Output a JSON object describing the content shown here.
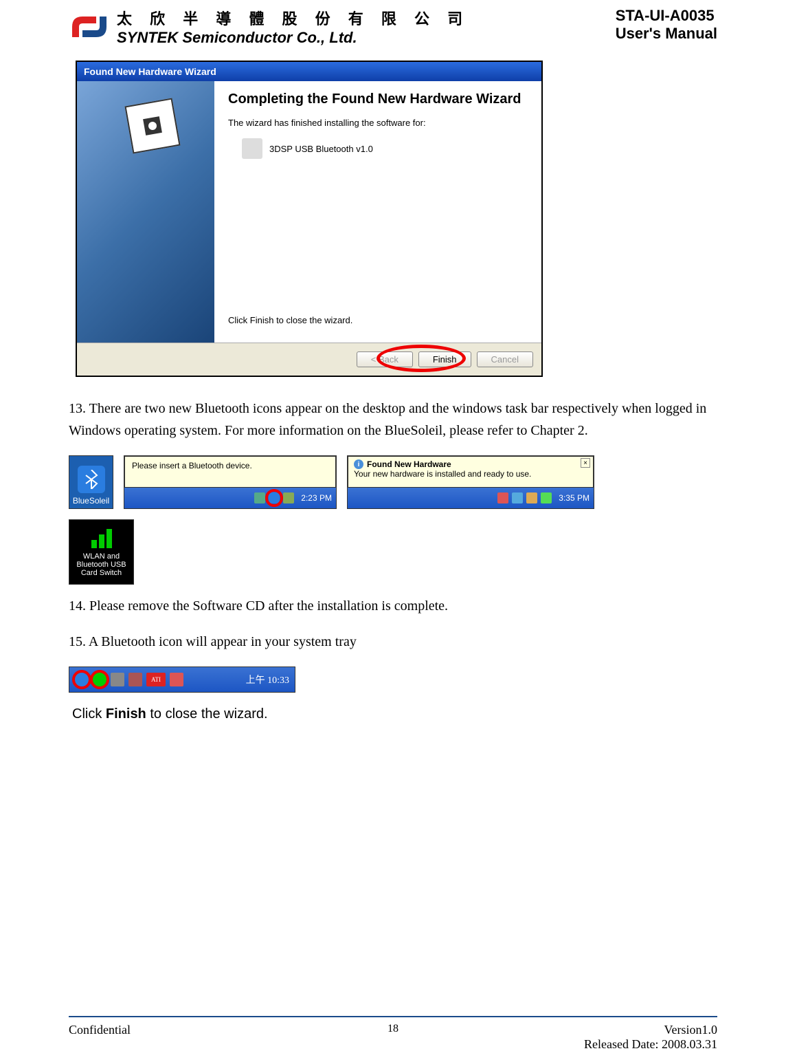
{
  "header": {
    "company_cn": "太 欣 半 導 體 股 份 有 限 公 司",
    "company_en": "SYNTEK Semiconductor Co., Ltd.",
    "doc_id": "STA-UI-A0035",
    "doc_type": "User's Manual"
  },
  "wizard": {
    "title": "Found New Hardware Wizard",
    "heading": "Completing the Found New Hardware Wizard",
    "subtext": "The wizard has finished installing the software for:",
    "device": "3DSP USB Bluetooth v1.0",
    "close_text": "Click Finish to close the wizard.",
    "btn_back": "< Back",
    "btn_finish": "Finish",
    "btn_cancel": "Cancel"
  },
  "steps": {
    "s13": "13. There are two new Bluetooth icons appear on the desktop and the windows task bar respectively when logged in Windows operating system. For more information on the BlueSoleil, please refer to Chapter 2.",
    "s14": "14. Please remove the Software CD after the installation is complete.",
    "s15": "15. A Bluetooth icon will appear in your system tray"
  },
  "icons": {
    "bluesoleil": "BlueSoleil",
    "tooltip_text": "Please insert a Bluetooth device.",
    "tooltip_time": "2:23 PM",
    "found_hw_title": "Found New Hardware",
    "found_hw_text": "Your new hardware is installed and ready to use.",
    "found_hw_time": "3:35 PM",
    "wlan_text": "WLAN and Bluetooth USB Card Switch",
    "systray_time": "上午 10:33",
    "ati_label": "ATI"
  },
  "close_wizard": {
    "prefix": "Click ",
    "bold": "Finish",
    "suffix": " to close the wizard."
  },
  "footer": {
    "confidential": "Confidential",
    "page": "18",
    "version": "Version1.0",
    "date": "Released Date: 2008.03.31"
  }
}
